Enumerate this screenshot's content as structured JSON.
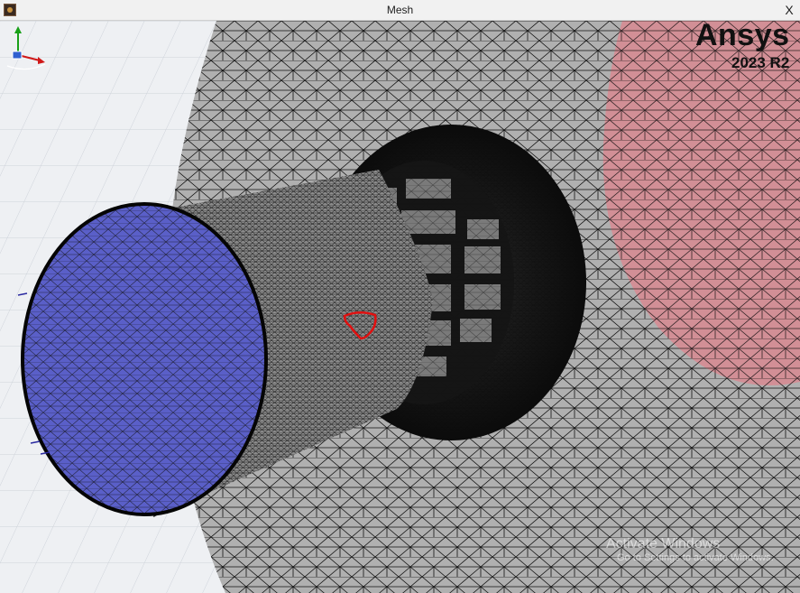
{
  "window": {
    "title": "Mesh",
    "close_label": "X"
  },
  "logo": {
    "brand": "Ansys",
    "version": "2023 R2"
  },
  "watermark": {
    "title": "Activate Windows",
    "subtitle": "Go to Settings to activate Windows."
  },
  "colors": {
    "inlet_face": "#5a5fc8",
    "outlet_face": "#d88a92",
    "mesh_body": "#a8a8a8",
    "highlight_outline": "#e01010",
    "background": "#e9ecf0"
  },
  "icons": {
    "app": "ansys-app-icon",
    "triad": "axis-triad-icon"
  }
}
